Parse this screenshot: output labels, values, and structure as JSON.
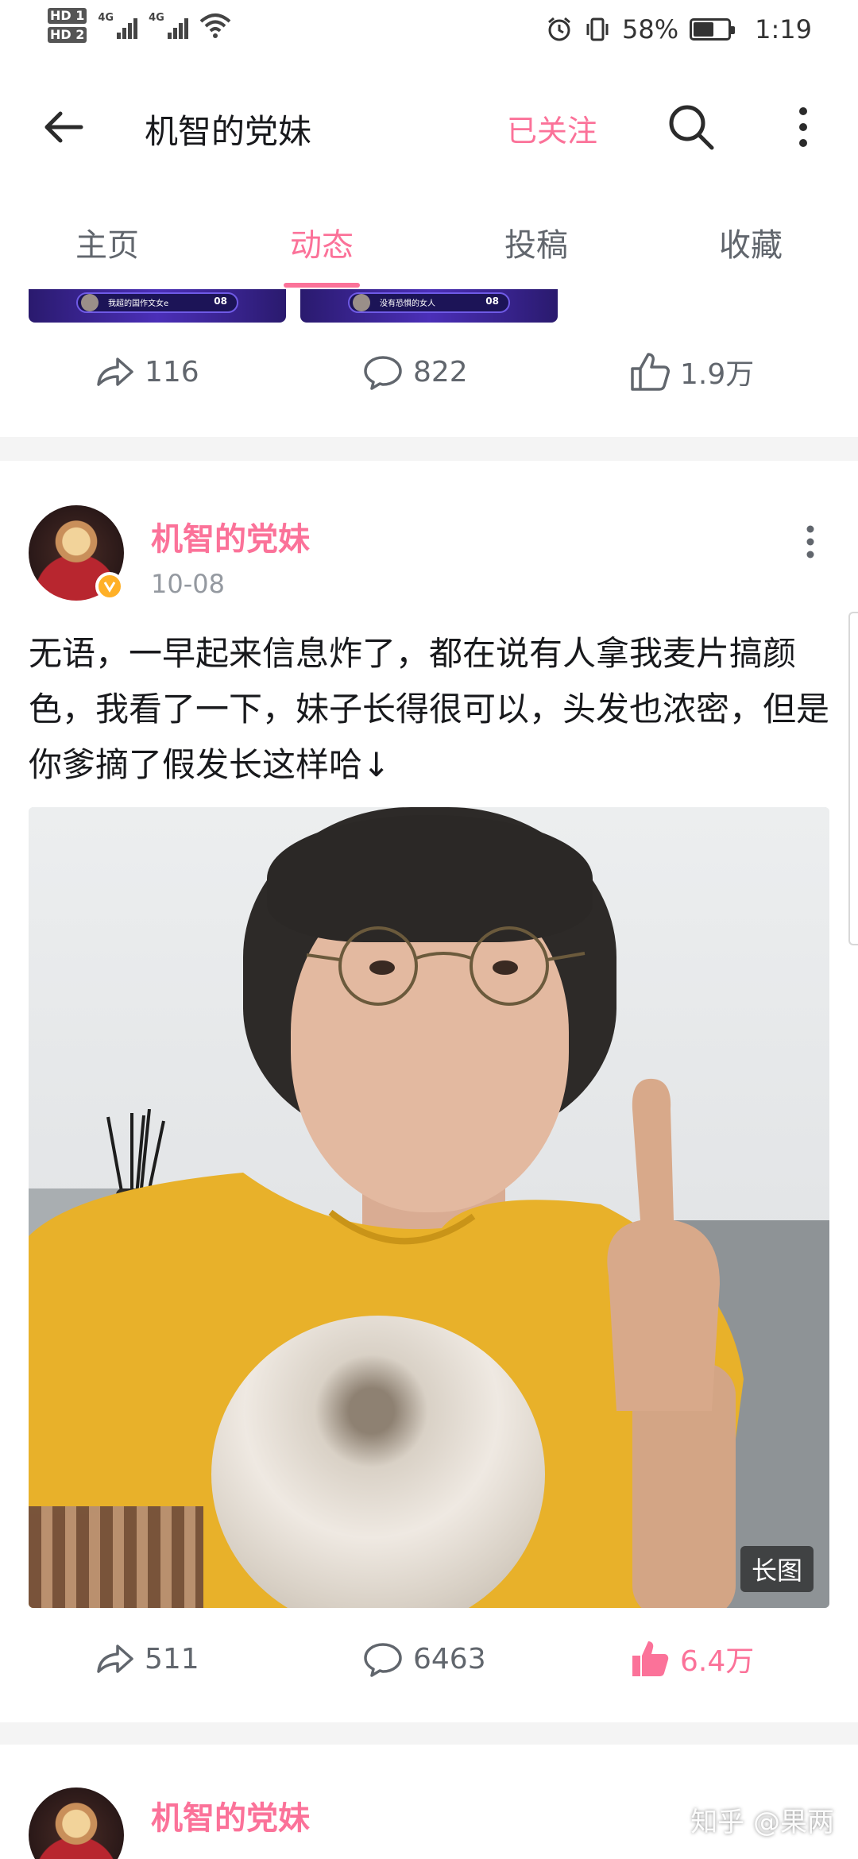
{
  "status_bar": {
    "hd1": "HD 1",
    "hd2": "HD 2",
    "net1": "4G",
    "net2": "4G",
    "battery_percent": "58%",
    "battery_level": 0.58,
    "time": "1:19"
  },
  "header": {
    "title": "机智的党妹",
    "follow_label": "已关注"
  },
  "tabs": [
    {
      "label": "主页",
      "active": false
    },
    {
      "label": "动态",
      "active": true
    },
    {
      "label": "投稿",
      "active": false
    },
    {
      "label": "收藏",
      "active": false
    }
  ],
  "prev_post": {
    "thumb1_name": "我超的国作文女e",
    "thumb1_num": "08",
    "thumb2_name": "没有恐惧的女人",
    "thumb2_num": "08",
    "forward_count": "116",
    "comment_count": "822",
    "like_count": "1.9万"
  },
  "post": {
    "author": "机智的党妹",
    "date": "10-08",
    "text": "无语，一早起来信息炸了，都在说有人拿我麦片搞颜色，我看了一下，妹子长得很可以，头发也浓密，但是你爹摘了假发长这样哈↓",
    "image_badge": "长图",
    "forward_count": "511",
    "comment_count": "6463",
    "like_count": "6.4万",
    "liked": true
  },
  "next_post": {
    "author": "机智的党妹"
  },
  "watermark": "知乎 @果两",
  "colors": {
    "accent": "#fb7299",
    "text_secondary": "#61666d",
    "text_meta": "#9499a0"
  }
}
